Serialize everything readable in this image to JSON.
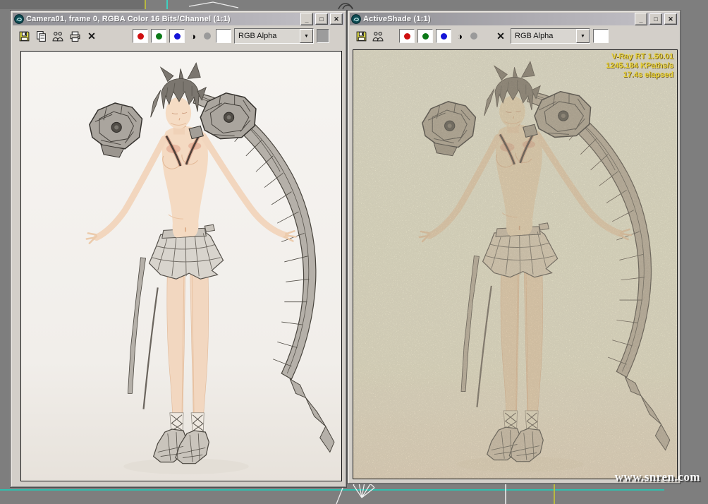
{
  "desktop": {
    "watermark": "www.snren.com"
  },
  "glyphs": {
    "minimize": "_",
    "maximize": "□",
    "close": "✕",
    "delete": "✕",
    "mono": "◑",
    "dropdown_arrow": "▼"
  },
  "left_window": {
    "title": "Camera01, frame 0, RGBA Color 16 Bits/Channel (1:1)",
    "toolbar": {
      "icons": [
        "save-icon",
        "copy-icon",
        "clone-rendered-frame-icon",
        "print-icon",
        "clear-icon"
      ],
      "channels": [
        "red",
        "green",
        "blue",
        "monochrome",
        "alpha"
      ],
      "dropdown_value": "RGB Alpha"
    }
  },
  "right_window": {
    "title": "ActiveShade (1:1)",
    "toolbar": {
      "icons": [
        "save-icon",
        "clone-rendered-frame-icon",
        "clear-icon"
      ],
      "channels": [
        "red",
        "green",
        "blue",
        "monochrome",
        "alpha"
      ],
      "dropdown_value": "RGB Alpha"
    },
    "render_stats": {
      "line1": "V-Ray RT 1.50.01",
      "line2": "1245.184 KPaths/s",
      "line3": "17.4s elapsed"
    }
  },
  "colors": {
    "vray_text": "#e8d23a",
    "channel_red": "#cf1010",
    "channel_green": "#0c7a18",
    "channel_blue": "#1515d8",
    "viewport_teal": "#2fbfae",
    "viewport_yellow": "#b9b941",
    "skin": "#f2d7c0",
    "wireframe_gray": "#b5b0a9"
  }
}
